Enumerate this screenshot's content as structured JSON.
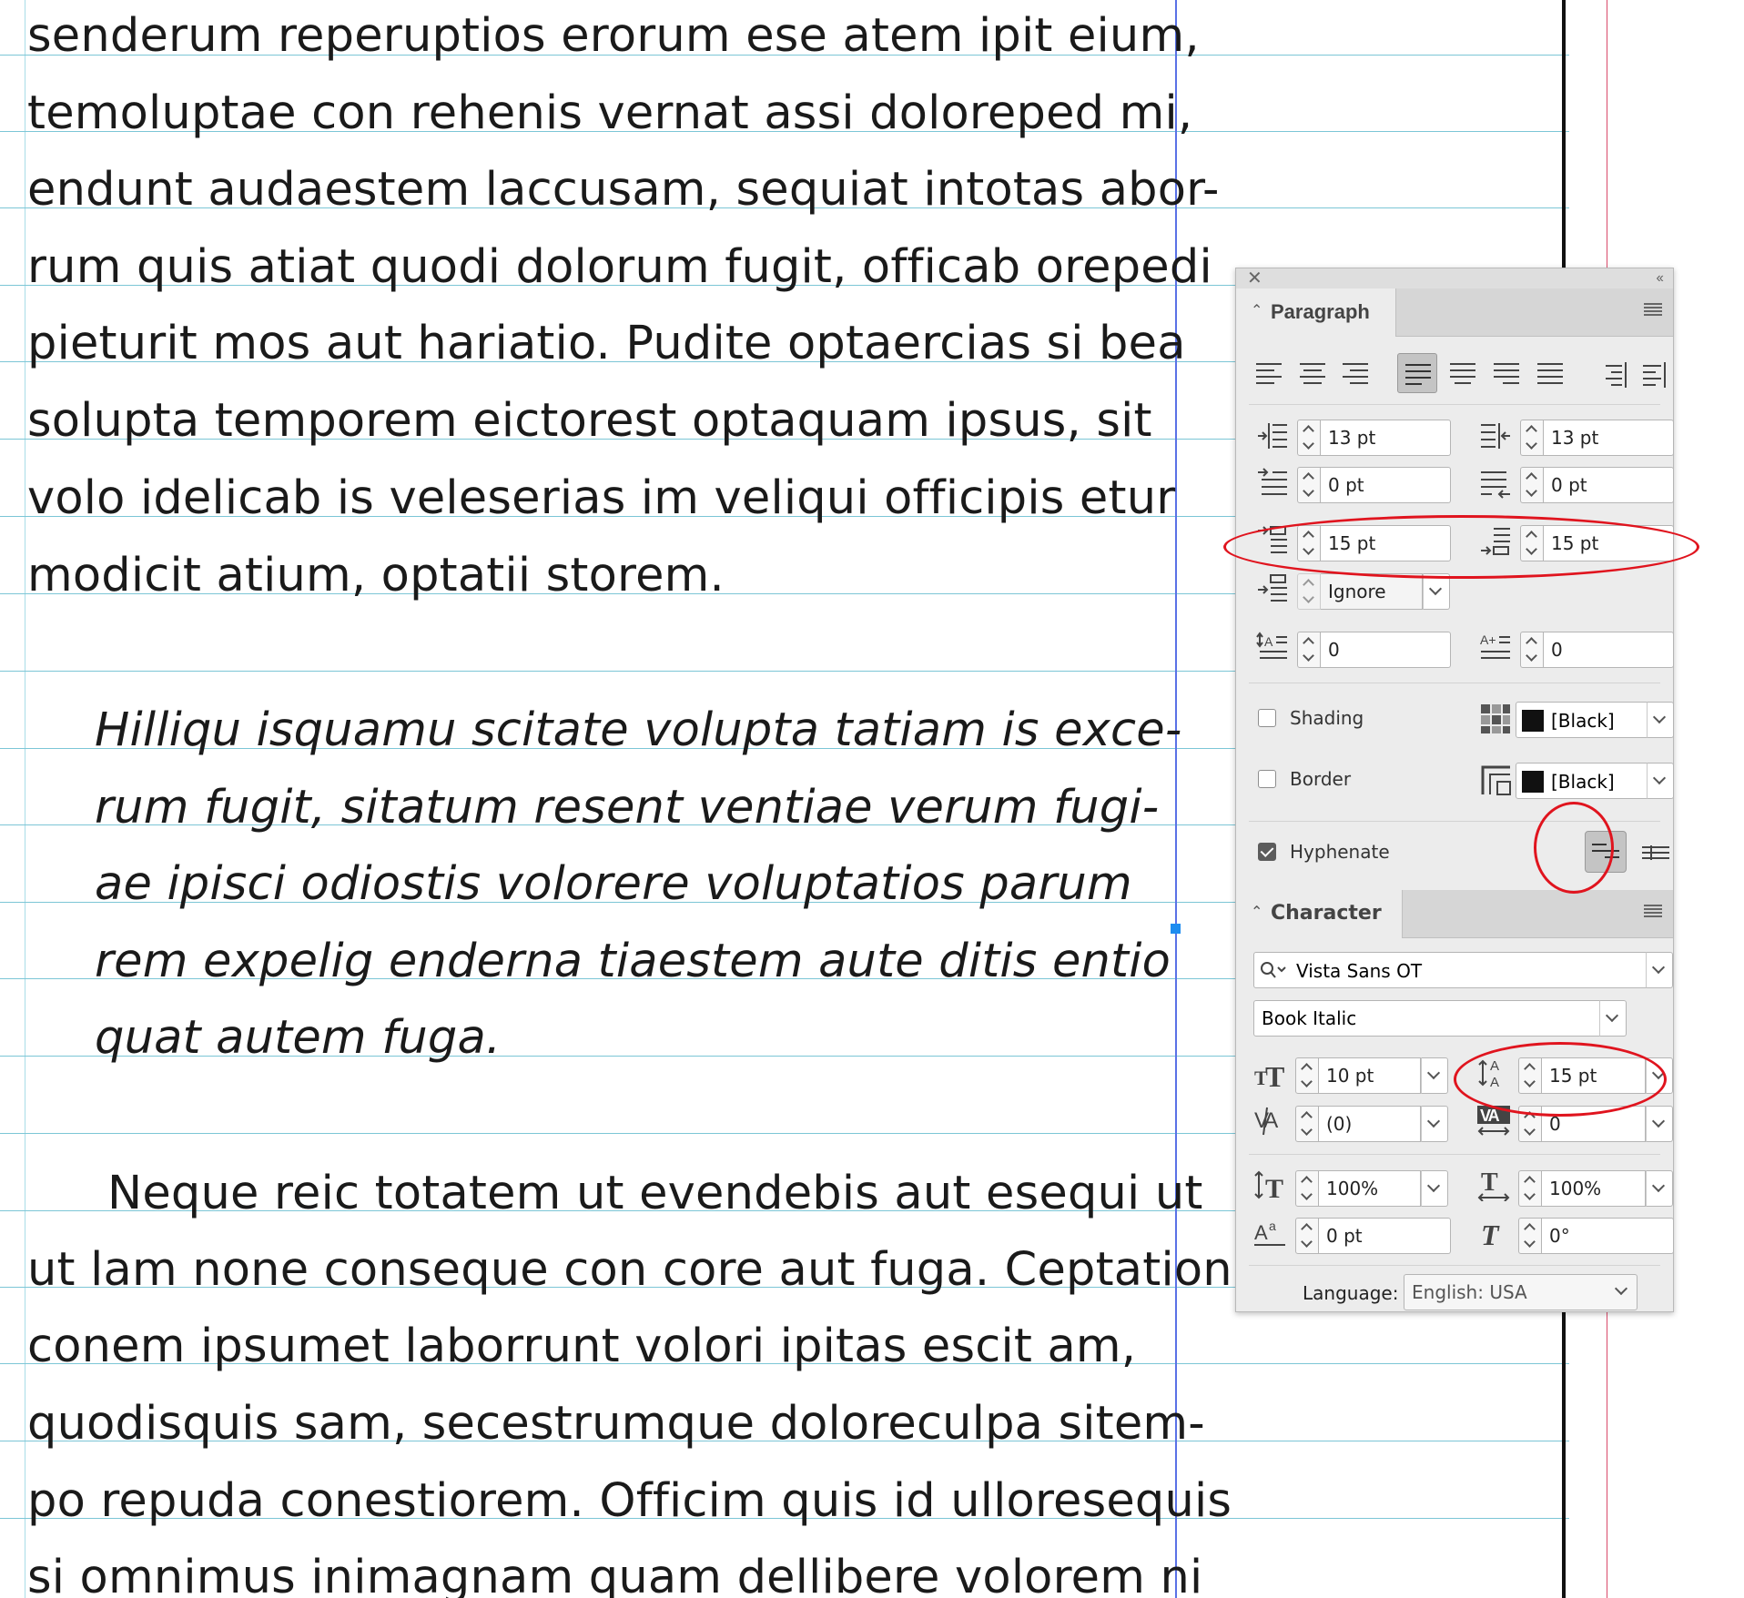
{
  "document": {
    "paragraph1": [
      "senderum reperuptios erorum ese atem ipit eium,",
      "temoluptae con rehenis vernat assi doloreped mi,",
      "endunt audaestem laccusam, sequiat intotas abor-",
      "rum quis atiat quodi dolorum fugit, officab orepedi",
      "pieturit mos aut hariatio. Pudite optaercias si bea",
      "solupta temporem eictorest optaquam ipsus, sit",
      "volo idelicab is veleserias im veliqui officipis etur",
      "modicit atium, optatii storem."
    ],
    "paragraph2": [
      "Hilliqu isquamu scitate volupta tatiam is exce-",
      "rum fugit, sitatum resent ventiae verum fugi-",
      "ae ipisci odiostis volorere voluptatios parum",
      "rem expelig enderna tiaestem aute ditis entio",
      "quat autem fuga."
    ],
    "paragraph3": [
      "Neque reic totatem ut evendebis aut esequi ut",
      "ut lam none conseque con core aut fuga. Ceptation",
      "conem ipsumet laborrunt volori ipitas escit am,",
      "quodisquis sam, secestrumque doloreculpa sitem-",
      "po repuda conestiorem. Officim quis id ulloresequis",
      "si omnimus inimagnam quam dellibere volorem ni"
    ]
  },
  "panel": {
    "close_glyph": "✕",
    "collapse_glyph": "‹‹",
    "paragraph": {
      "tab_label": "Paragraph",
      "left_indent": "13 pt",
      "right_indent": "13 pt",
      "first_line_indent": "0 pt",
      "last_line_indent": "0 pt",
      "space_before": "15 pt",
      "space_after": "15 pt",
      "align_to_grid": "Ignore",
      "drop_cap_lines": "0",
      "drop_cap_chars": "0",
      "shading_label": "Shading",
      "shading_swatch": "[Black]",
      "border_label": "Border",
      "border_swatch": "[Black]",
      "hyphenate_label": "Hyphenate",
      "hyphenate_checked": true
    },
    "character": {
      "tab_label": "Character",
      "font_family": "Vista Sans OT",
      "font_style": "Book Italic",
      "font_size": "10 pt",
      "leading": "15 pt",
      "kerning": "(0)",
      "tracking": "0",
      "vertical_scale": "100%",
      "horizontal_scale": "100%",
      "baseline_shift": "0 pt",
      "skew": "0°",
      "language_label": "Language:",
      "language_value": "English: USA"
    },
    "annotation_color": "#e0141e"
  }
}
